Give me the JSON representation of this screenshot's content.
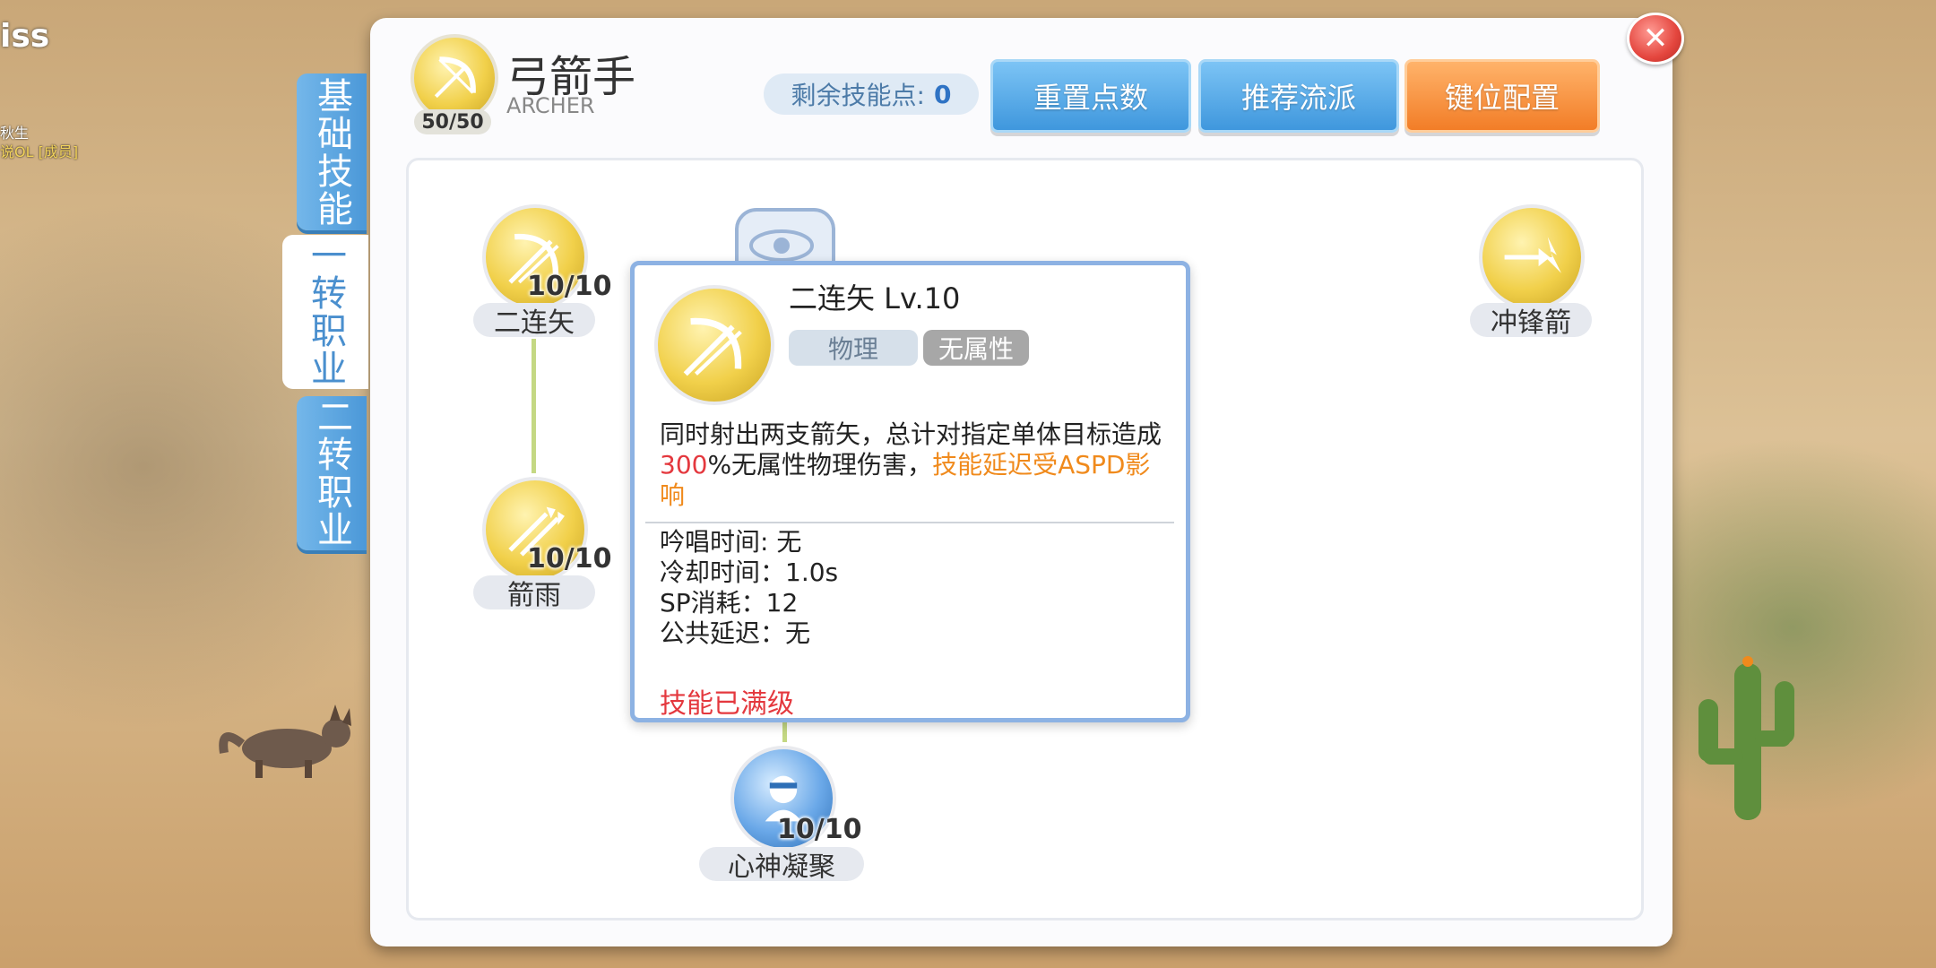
{
  "background": {
    "top_text": "iss",
    "small_text_1": "秋生",
    "small_text_2": "说OL [成员]"
  },
  "class": {
    "name": "弓箭手",
    "name_en": "ARCHER",
    "level": "50/50"
  },
  "side_tabs": [
    "基础技能",
    "一转职业",
    "二转职业"
  ],
  "skill_points": {
    "label": "剩余技能点:",
    "value": "0"
  },
  "buttons": {
    "reset": "重置点数",
    "recommend": "推荐流派",
    "keybind": "键位配置"
  },
  "skills": {
    "double_arrow": {
      "name": "二连矢",
      "level": "10/10",
      "icon": "bow-arrow-icon"
    },
    "arrow_rain": {
      "name": "箭雨",
      "level": "10/10",
      "icon": "arrow-rain-icon"
    },
    "focus": {
      "name": "心神凝聚",
      "level": "10/10",
      "icon": "meditation-icon"
    },
    "charge_arrow": {
      "name": "冲锋箭",
      "icon": "charge-arrow-icon"
    }
  },
  "tooltip": {
    "title": "二连矢 Lv.10",
    "tag_type": "物理",
    "tag_element": "无属性",
    "desc_part1": "同时射出两支箭矢，总计对指定单体目标造成",
    "desc_percent": "300",
    "desc_part2": "%无属性物理伤害，",
    "desc_highlight": "技能延迟受ASPD影响",
    "cast_time": "吟唱时间: 无",
    "cooldown": "冷却时间：1.0s",
    "sp_cost": "SP消耗：12",
    "global_delay": "公共延迟：无",
    "max_level": "技能已满级"
  },
  "colors": {
    "accent_blue": "#4b98d8",
    "accent_orange": "#f27d27",
    "close_red": "#e4463e",
    "gold": "#f1d04a",
    "highlight_red": "#e4383e",
    "highlight_orange": "#f08a1c"
  }
}
